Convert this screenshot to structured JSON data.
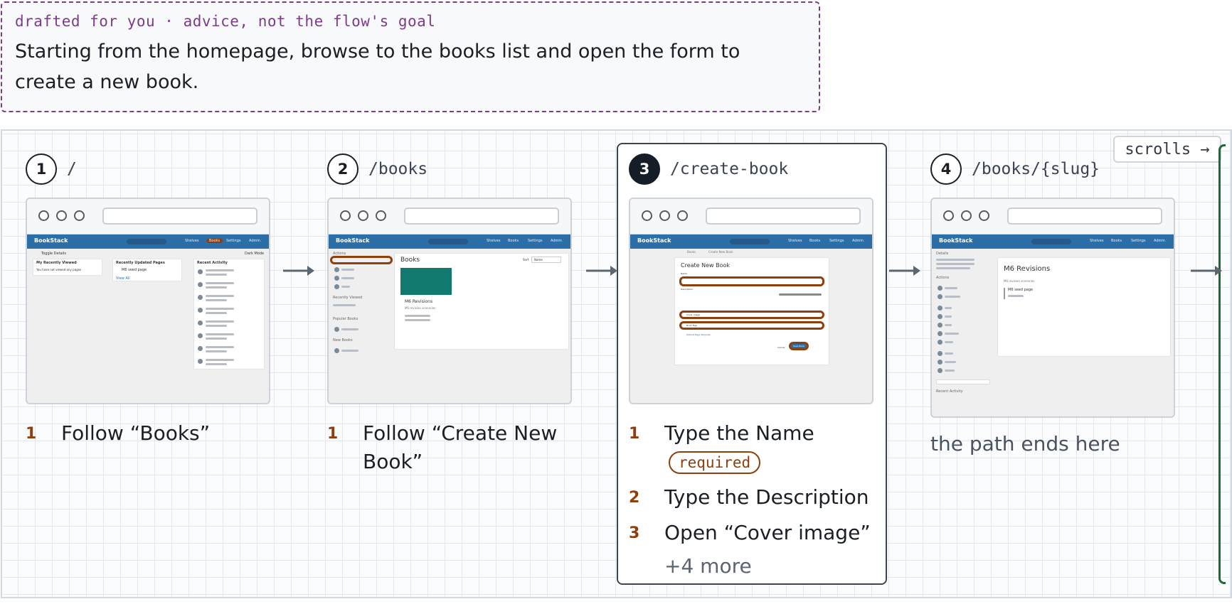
{
  "banner": {
    "kicker": "drafted for you · advice, not the flow's goal",
    "text": "Starting from the homepage, browse to the books list and open the form to create a new book."
  },
  "scroll_hint": "scrolls →",
  "mock_app": {
    "logo": "BookStack",
    "search": "Search",
    "nav": [
      "Shelves",
      "Books",
      "Settings",
      "Admin"
    ]
  },
  "flow": [
    {
      "number": "1",
      "route": "/",
      "active": false,
      "screen": {
        "toggle": "Toggle Details",
        "dark": "Dark Mode",
        "recent_viewed_title": "My Recently Viewed",
        "recent_viewed_empty": "You have not viewed any pages",
        "updated_title": "Recently Updated Pages",
        "updated_item": "M6 seed page",
        "view_all": "View All",
        "activity_title": "Recent Activity"
      },
      "steps": [
        {
          "n": "1",
          "text": "Follow “Books”",
          "required": ""
        }
      ],
      "more": "",
      "end_note": ""
    },
    {
      "number": "2",
      "route": "/books",
      "active": false,
      "screen": {
        "actions": "Actions",
        "recent_viewed": "Recently Viewed",
        "popular": "Popular Books",
        "new_books": "New Books",
        "page_title": "Books",
        "sort": "Sort",
        "sort_value": "Name",
        "book_name": "M6 Revisions",
        "book_desc": "M6 revision scenarios"
      },
      "steps": [
        {
          "n": "1",
          "text": "Follow “Create New Book”",
          "required": ""
        }
      ],
      "more": "",
      "end_note": ""
    },
    {
      "number": "3",
      "route": "/create-book",
      "active": true,
      "screen": {
        "crumb1": "Books",
        "crumb2": "Create New Book",
        "form_title": "Create New Book",
        "name_label": "Name",
        "desc_label": "Description",
        "cover": "Cover image",
        "tags": "Book Tags",
        "default_template": "Default Page Template",
        "cancel": "Cancel",
        "save": "Save Book"
      },
      "steps": [
        {
          "n": "1",
          "text": "Type the Name",
          "required": "required"
        },
        {
          "n": "2",
          "text": "Type the Description",
          "required": ""
        },
        {
          "n": "3",
          "text": "Open “Cover image”",
          "required": ""
        }
      ],
      "more": "+4 more",
      "end_note": ""
    },
    {
      "number": "4",
      "route": "/books/{slug}",
      "active": false,
      "screen": {
        "details": "Details",
        "actions": "Actions",
        "recent_activity": "Recent Activity",
        "book_title": "M6 Revisions",
        "book_desc": "M6 revision scenarios",
        "page_item": "M6 seed page"
      },
      "steps": [],
      "more": "",
      "end_note": "the path ends here"
    }
  ],
  "colors": {
    "accent": "#8f3e0c",
    "app_header": "#2c6fa8",
    "active_badge": "#151d26",
    "dashed_border": "#7a3d86"
  }
}
